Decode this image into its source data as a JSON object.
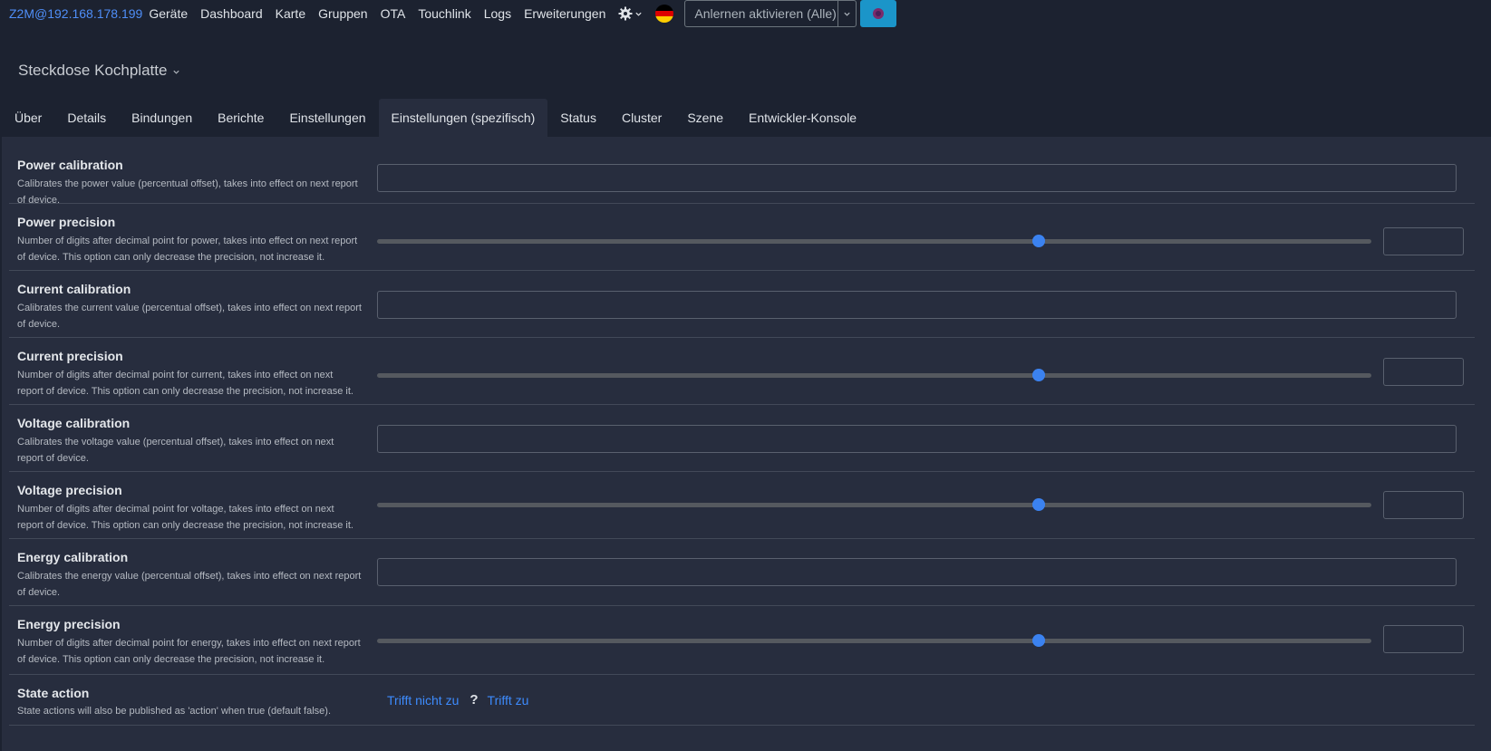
{
  "nav": {
    "brand": "Z2M@192.168.178.199",
    "links": [
      "Geräte",
      "Dashboard",
      "Karte",
      "Gruppen",
      "OTA",
      "Touchlink",
      "Logs",
      "Erweiterungen"
    ],
    "gear_icon": "gear-icon",
    "flag_colors": [
      "#000000",
      "#dd0000",
      "#ffce00"
    ],
    "permit_join_label": "Anlernen aktivieren (Alle)",
    "status_color": "#1b95c9"
  },
  "device": {
    "title": "Steckdose Kochplatte"
  },
  "tabs": [
    {
      "label": "Über",
      "active": false
    },
    {
      "label": "Details",
      "active": false
    },
    {
      "label": "Bindungen",
      "active": false
    },
    {
      "label": "Berichte",
      "active": false
    },
    {
      "label": "Einstellungen",
      "active": false
    },
    {
      "label": "Einstellungen (spezifisch)",
      "active": true
    },
    {
      "label": "Status",
      "active": false
    },
    {
      "label": "Cluster",
      "active": false
    },
    {
      "label": "Szene",
      "active": false
    },
    {
      "label": "Entwickler-Konsole",
      "active": false
    }
  ],
  "settings": [
    {
      "label": "Power calibration",
      "desc": "Calibrates the power value (percentual offset), takes into effect on next report of device.",
      "control": "text"
    },
    {
      "label": "Power precision",
      "desc": "Number of digits after decimal point for power, takes into effect on next report of device. This option can only decrease the precision, not increase it.",
      "control": "slider",
      "slider_fraction": 0.665
    },
    {
      "label": "Current calibration",
      "desc": "Calibrates the current value (percentual offset), takes into effect on next report of device.",
      "control": "text"
    },
    {
      "label": "Current precision",
      "desc": "Number of digits after decimal point for current, takes into effect on next report of device. This option can only decrease the precision, not increase it.",
      "control": "slider",
      "slider_fraction": 0.665
    },
    {
      "label": "Voltage calibration",
      "desc": "Calibrates the voltage value (percentual offset), takes into effect on next report of device.",
      "control": "text"
    },
    {
      "label": "Voltage precision",
      "desc": "Number of digits after decimal point for voltage, takes into effect on next report of device. This option can only decrease the precision, not increase it.",
      "control": "slider",
      "slider_fraction": 0.665
    },
    {
      "label": "Energy calibration",
      "desc": "Calibrates the energy value (percentual offset), takes into effect on next report of device.",
      "control": "text"
    },
    {
      "label": "Energy precision",
      "desc": "Number of digits after decimal point for energy, takes into effect on next report of device. This option can only decrease the precision, not increase it.",
      "control": "slider",
      "slider_fraction": 0.665
    }
  ],
  "state_action": {
    "label": "State action",
    "desc": "State actions will also be published as 'action' when true (default false).",
    "false_label": "Trifft nicht zu",
    "unknown_label": "?",
    "true_label": "Trifft zu"
  }
}
